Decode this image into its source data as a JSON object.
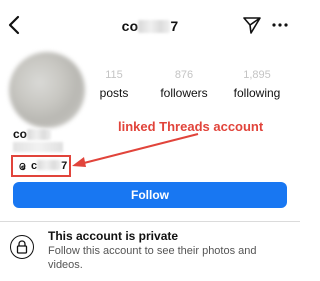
{
  "header": {
    "username_prefix": "co",
    "username_suffix": "7",
    "back_icon": "chevron-left-icon",
    "send_icon": "paper-plane-icon",
    "more_icon": "more-horizontal-icon"
  },
  "stats": [
    {
      "value": "115",
      "label": "posts"
    },
    {
      "value": "876",
      "label": "followers"
    },
    {
      "value": "1,895",
      "label": "following"
    }
  ],
  "profile": {
    "name_prefix": "co"
  },
  "threads": {
    "handle_prefix": "c",
    "handle_suffix": "7",
    "icon": "threads-at-icon"
  },
  "annotation": {
    "text": "linked Threads account",
    "color": "#e1443b"
  },
  "follow_button": {
    "label": "Follow",
    "color": "#1877f2"
  },
  "private_notice": {
    "title": "This account is private",
    "description": "Follow this account to see their photos and videos.",
    "icon": "lock-icon"
  }
}
